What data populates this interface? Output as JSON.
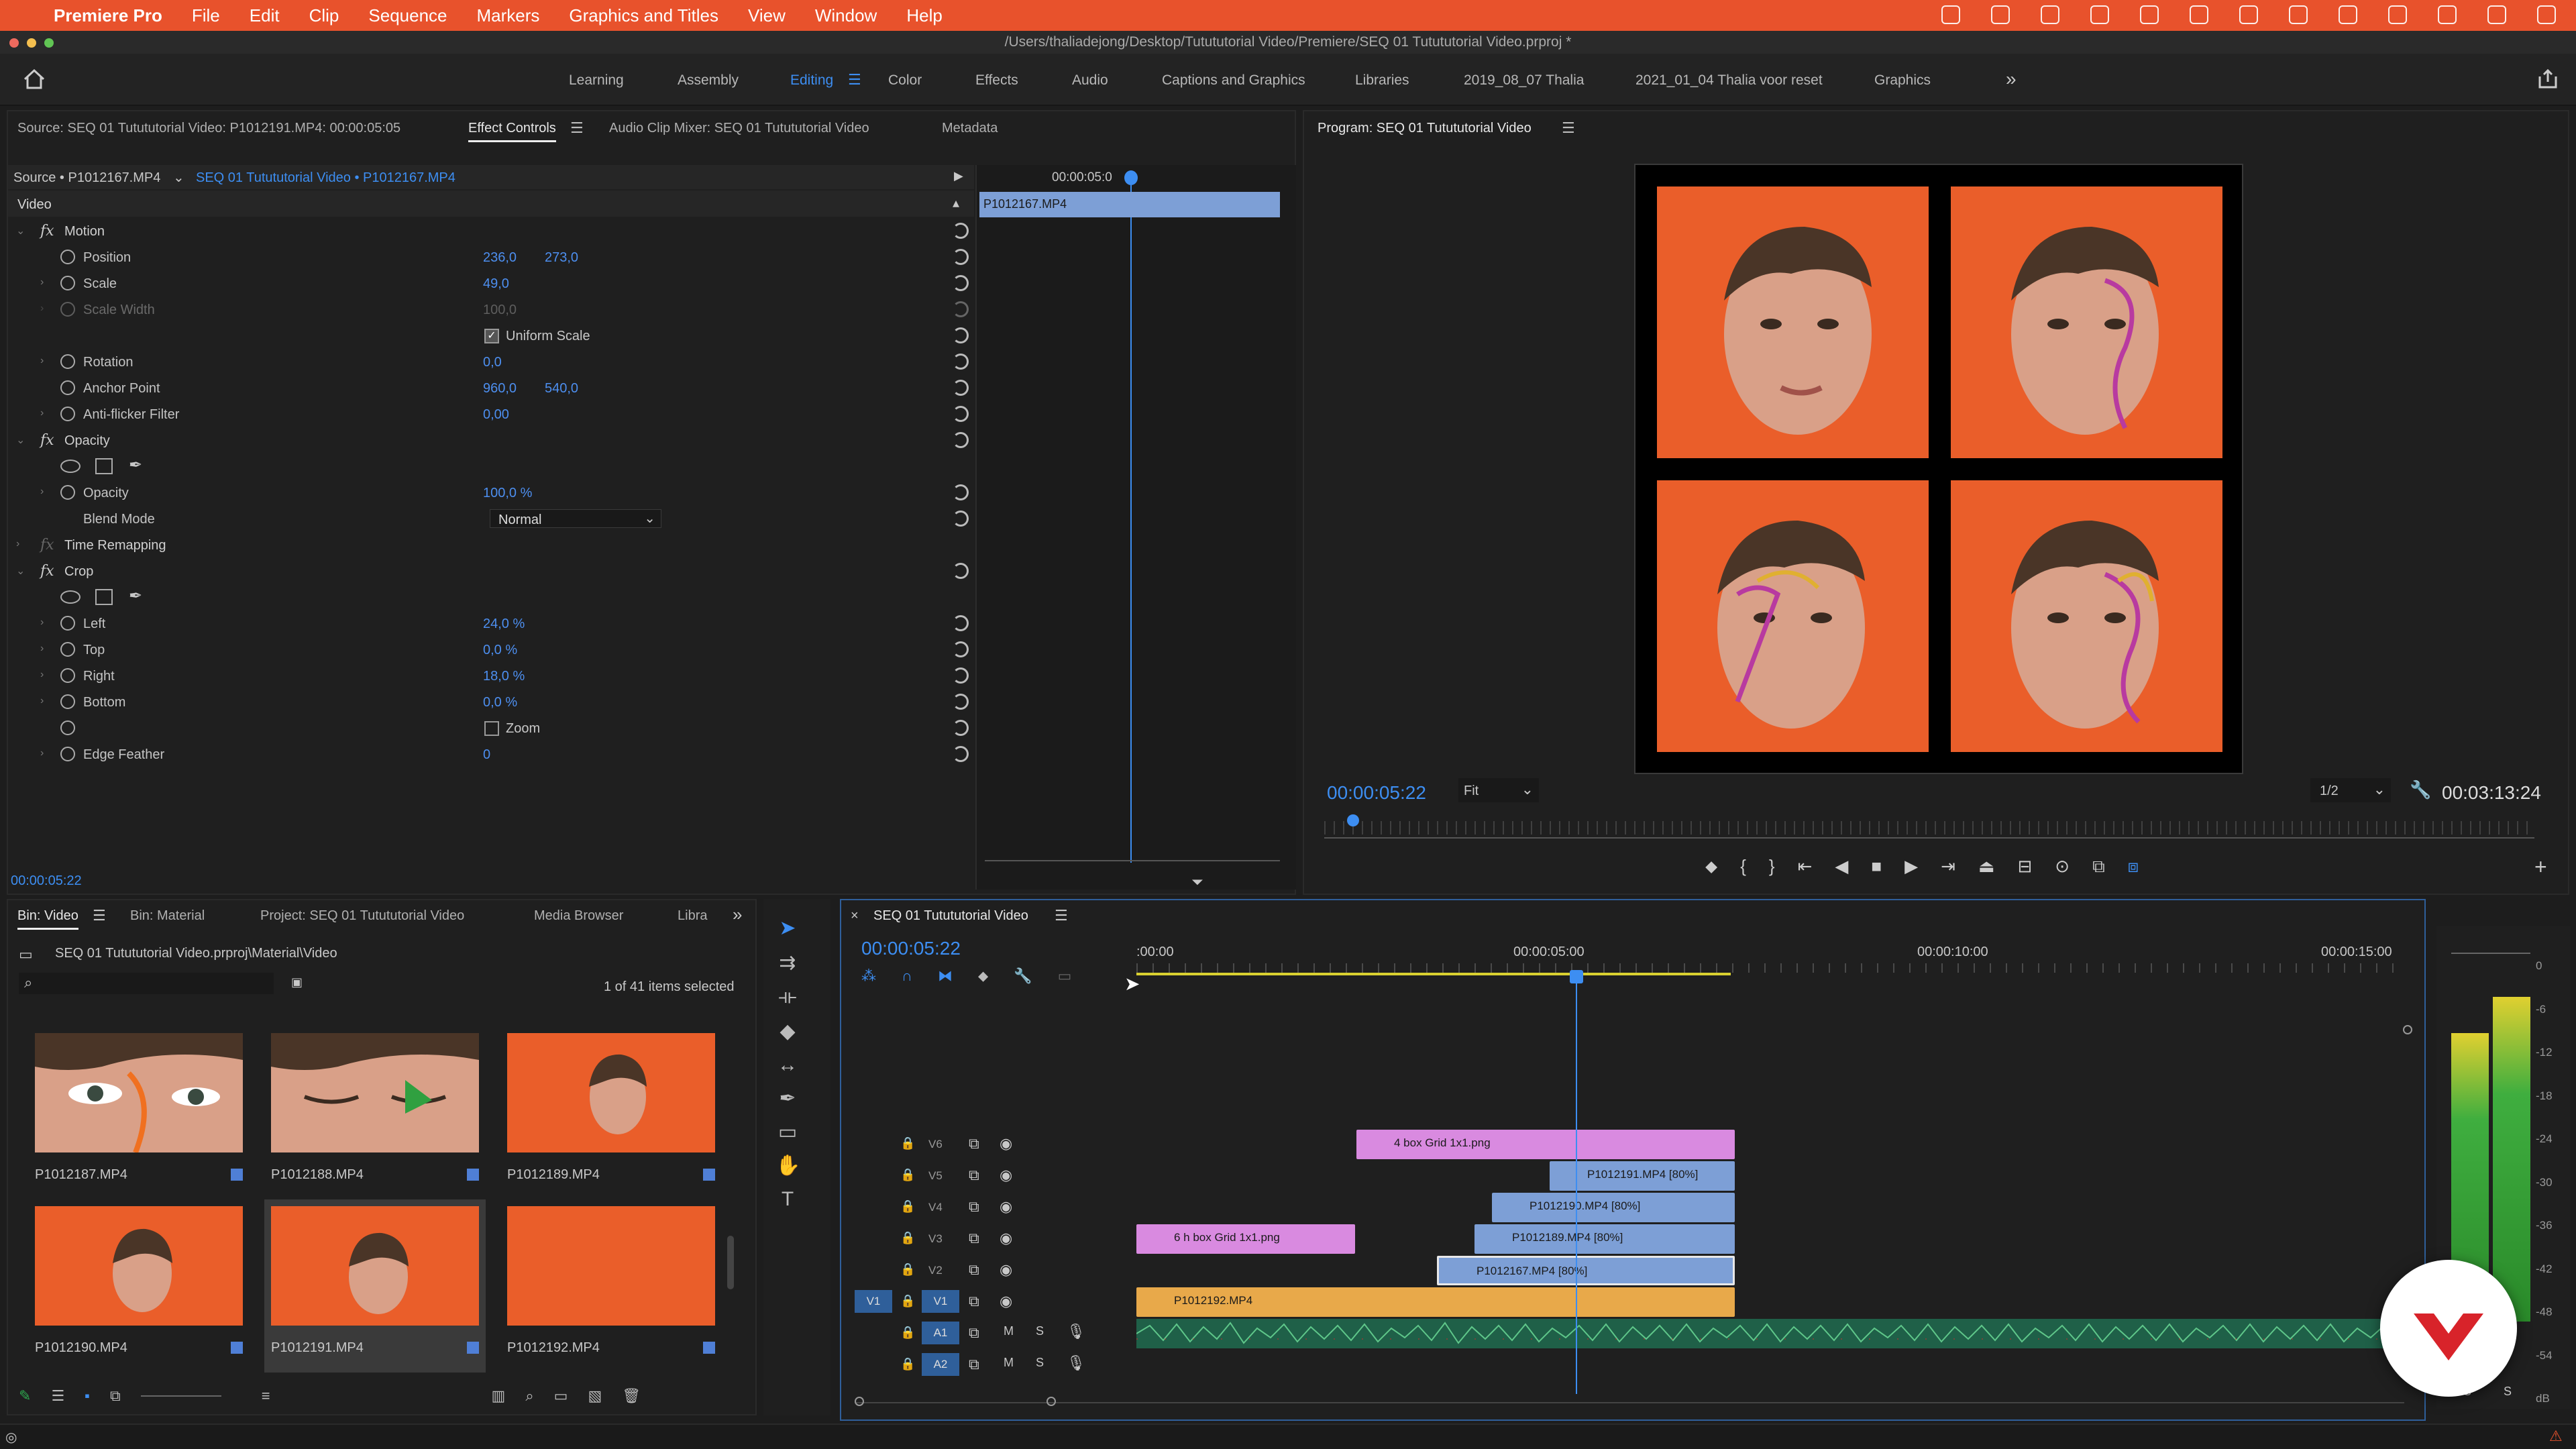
{
  "menubar": {
    "app": "Premiere Pro",
    "items": [
      "File",
      "Edit",
      "Clip",
      "Sequence",
      "Markers",
      "Graphics and Titles",
      "View",
      "Window",
      "Help"
    ]
  },
  "titlebar": {
    "path": "/Users/thaliadejong/Desktop/Tutututorial Video/Premiere/SEQ 01 Tutututorial Video.prproj *"
  },
  "workspaces": {
    "tabs": [
      "Learning",
      "Assembly",
      "Editing",
      "Color",
      "Effects",
      "Audio",
      "Captions and Graphics",
      "Libraries",
      "2019_08_07 Thalia",
      "2021_01_04 Thalia voor reset",
      "Graphics"
    ],
    "active": "Editing"
  },
  "effect_panel": {
    "tabs": [
      "Source: SEQ 01 Tutututorial Video: P1012191.MP4: 00:00:05:05",
      "Effect Controls",
      "Audio Clip Mixer: SEQ 01 Tutututorial Video",
      "Metadata"
    ],
    "source": "Source • P1012167.MP4",
    "sequence": "SEQ 01 Tutututorial Video • P1012167.MP4",
    "mini_time": "00:00:05:0",
    "mini_clip": "P1012167.MP4",
    "section": "Video",
    "motion": "Motion",
    "position_label": "Position",
    "position_x": "236,0",
    "position_y": "273,0",
    "scale_label": "Scale",
    "scale": "49,0",
    "scale_width_label": "Scale Width",
    "scale_width": "100,0",
    "uniform_label": "Uniform Scale",
    "rotation_label": "Rotation",
    "rotation": "0,0",
    "anchor_label": "Anchor Point",
    "anchor_x": "960,0",
    "anchor_y": "540,0",
    "antiflicker_label": "Anti-flicker Filter",
    "antiflicker": "0,00",
    "opacity_group": "Opacity",
    "opacity_label": "Opacity",
    "opacity": "100,0 %",
    "blend_label": "Blend Mode",
    "blend": "Normal",
    "time_remap": "Time Remapping",
    "crop_group": "Crop",
    "left_label": "Left",
    "left": "24,0 %",
    "top_label": "Top",
    "top": "0,0 %",
    "right_label": "Right",
    "right": "18,0 %",
    "bottom_label": "Bottom",
    "bottom": "0,0 %",
    "zoom_label": "Zoom",
    "edge_label": "Edge Feather",
    "edge": "0",
    "timecode": "00:00:05:22"
  },
  "program": {
    "title": "Program: SEQ 01 Tutututorial Video",
    "timecode": "00:00:05:22",
    "fit": "Fit",
    "resolution": "1/2",
    "duration": "00:03:13:24"
  },
  "bin": {
    "tabs": [
      "Bin: Video",
      "Bin: Material",
      "Project: SEQ 01 Tutututorial Video",
      "Media Browser",
      "Libra"
    ],
    "path": "SEQ 01 Tutututorial Video.prproj\\Material\\Video",
    "selected": "1 of 41 items selected",
    "items": [
      "P1012187.MP4",
      "P1012188.MP4",
      "P1012189.MP4",
      "P1012190.MP4",
      "P1012191.MP4",
      "P1012192.MP4"
    ]
  },
  "timeline": {
    "title": "SEQ 01 Tutututorial Video",
    "timecode": "00:00:05:22",
    "ruler": [
      ":00:00",
      "00:00:05:00",
      "00:00:10:00",
      "00:00:15:00"
    ],
    "tracks": [
      "V6",
      "V5",
      "V4",
      "V3",
      "V2",
      "V1",
      "A1",
      "A2"
    ],
    "src_v1": "V1",
    "src_a1": "A1",
    "src_a2": "A2",
    "clips": {
      "grid4": "4 box Grid 1x1.png",
      "p191": "P1012191.MP4 [80%]",
      "p190": "P1012190.MP4 [80%]",
      "p189": "P1012189.MP4 [80%]",
      "grid6": "6 h box Grid 1x1.png",
      "p167": "P1012167.MP4 [80%]",
      "p192": "P1012192.MP4"
    }
  },
  "meters": [
    "0",
    "-6",
    "-12",
    "-18",
    "-24",
    "-30",
    "-36",
    "-42",
    "-48",
    "-54",
    "dB"
  ],
  "meter_solo": [
    "S",
    "S"
  ],
  "colors": {
    "accent": "#3d8ef2",
    "orange": "#ea5e2a",
    "macbar": "#e8522c",
    "pink": "#d98ae0",
    "blue_clip": "#7d9fd6",
    "gold": "#e8a94a"
  }
}
